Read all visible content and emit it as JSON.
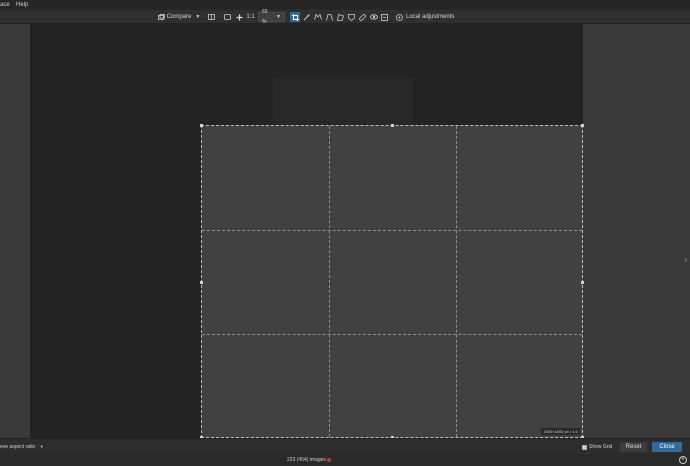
{
  "menubar": {
    "items": [
      "ace",
      "Help"
    ]
  },
  "toolbar": {
    "compare_label": "Compare",
    "one_to_one_label": "1:1",
    "zoom_value": "69 %",
    "local_adjustments_label": "Local adjustments"
  },
  "crop": {
    "size_label": "1000×1000 px • 1:1"
  },
  "bottombar": {
    "aspect_label": "eve aspect ratio",
    "show_grid_label": "Show Grid",
    "show_grid_checked": true,
    "reset_label": "Reset",
    "close_label": "Close"
  },
  "status": {
    "images_label": "223 (454) images"
  }
}
